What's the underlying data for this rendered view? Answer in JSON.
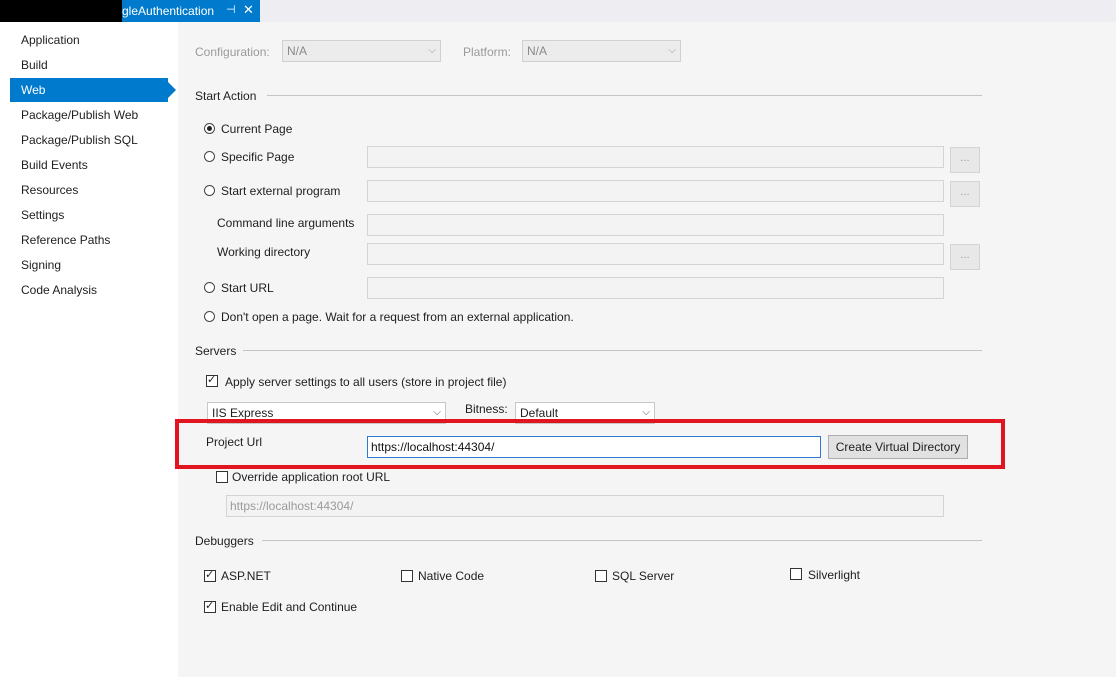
{
  "tab": {
    "title": "gleAuthentication",
    "pin_glyph": "⊣",
    "close_glyph": "✕"
  },
  "sidebar": {
    "items": [
      {
        "label": "Application"
      },
      {
        "label": "Build"
      },
      {
        "label": "Web",
        "active": true
      },
      {
        "label": "Package/Publish Web"
      },
      {
        "label": "Package/Publish SQL"
      },
      {
        "label": "Build Events"
      },
      {
        "label": "Resources"
      },
      {
        "label": "Settings"
      },
      {
        "label": "Reference Paths"
      },
      {
        "label": "Signing"
      },
      {
        "label": "Code Analysis"
      }
    ]
  },
  "config": {
    "configuration_label": "Configuration:",
    "configuration_value": "N/A",
    "platform_label": "Platform:",
    "platform_value": "N/A"
  },
  "start_action": {
    "heading": "Start Action",
    "current_page": "Current Page",
    "specific_page": "Specific Page",
    "start_external": "Start external program",
    "cmd_args": "Command line arguments",
    "working_dir": "Working directory",
    "start_url": "Start URL",
    "dont_open": "Don't open a page.  Wait for a request from an external application.",
    "browse_glyph": "..."
  },
  "servers": {
    "heading": "Servers",
    "apply_all": "Apply server settings to all users (store in project file)",
    "server_value": "IIS Express",
    "bitness_label": "Bitness:",
    "bitness_value": "Default",
    "project_url_label": "Project Url",
    "project_url_value": "https://localhost:44304/",
    "create_vdir": "Create Virtual Directory",
    "override_root": "Override application root URL",
    "override_value": "https://localhost:44304/"
  },
  "debuggers": {
    "heading": "Debuggers",
    "aspnet": "ASP.NET",
    "native": "Native Code",
    "sql": "SQL Server",
    "silverlight": "Silverlight",
    "edit_continue": "Enable Edit and Continue",
    "check_glyph": "✓",
    "chevron_glyph": "⌵"
  },
  "colors": {
    "accent": "#007acc",
    "highlight": "#e0151f"
  }
}
